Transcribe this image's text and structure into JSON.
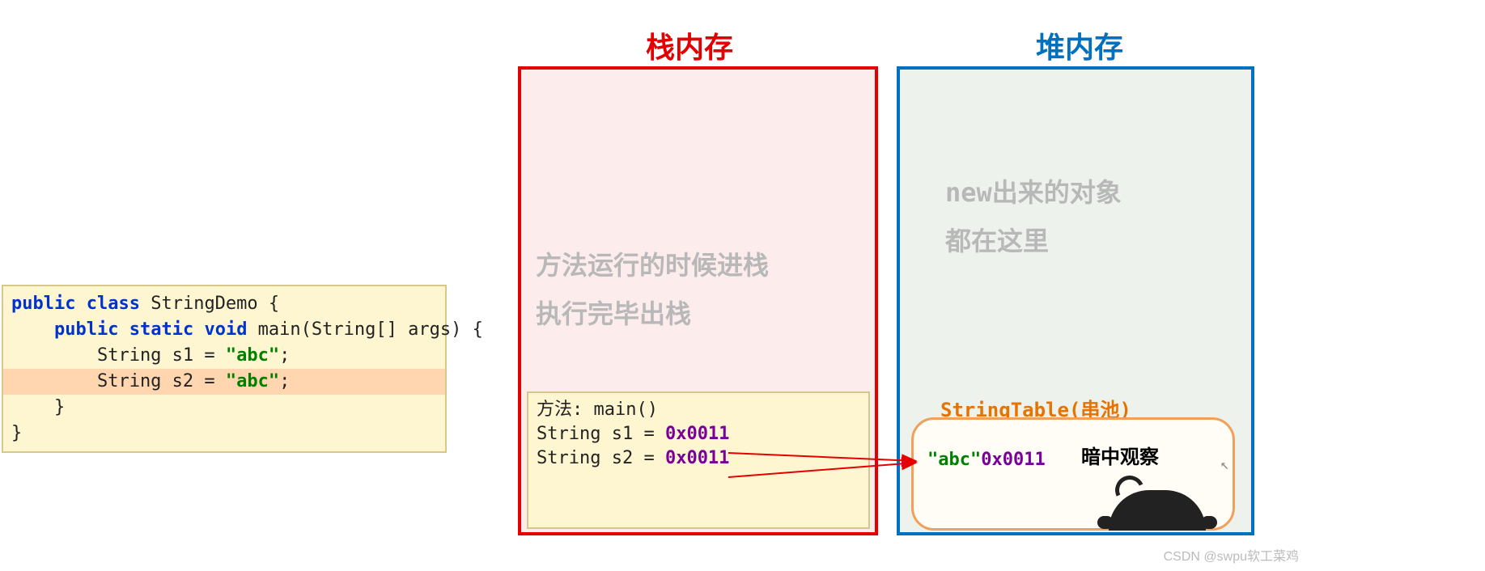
{
  "code": {
    "line1_kw1": "public",
    "line1_kw2": "class",
    "line1_rest": " StringDemo {",
    "line2_kw1": "public",
    "line2_kw2": "static",
    "line2_kw3": "void",
    "line2_rest": " main(String[] args) {",
    "line3_pre": "        String s1 = ",
    "line3_str": "\"abc\"",
    "line3_post": ";",
    "line4_pre": "        String s2 = ",
    "line4_str": "\"abc\"",
    "line4_post": ";",
    "line5": "    }",
    "line6": "}"
  },
  "stack": {
    "title": "栈内存",
    "desc1": "方法运行的时候进栈",
    "desc2": "执行完毕出栈",
    "frame_title": "方法: main()",
    "s1_pre": " String s1 = ",
    "s1_addr": "0x0011",
    "s2_pre": " String s2 = ",
    "s2_addr": "0x0011"
  },
  "heap": {
    "title": "堆内存",
    "desc1": "new出来的对象",
    "desc2": "都在这里",
    "strtable_label": "StringTable(串池)",
    "pool_str": "\"abc\"",
    "pool_addr": "0x0011",
    "observe": "暗中观察"
  },
  "watermark": "CSDN @swpu软工菜鸡",
  "colors": {
    "stack_border": "#e40000",
    "heap_border": "#0070c0",
    "pool_border": "#f0a05a"
  }
}
